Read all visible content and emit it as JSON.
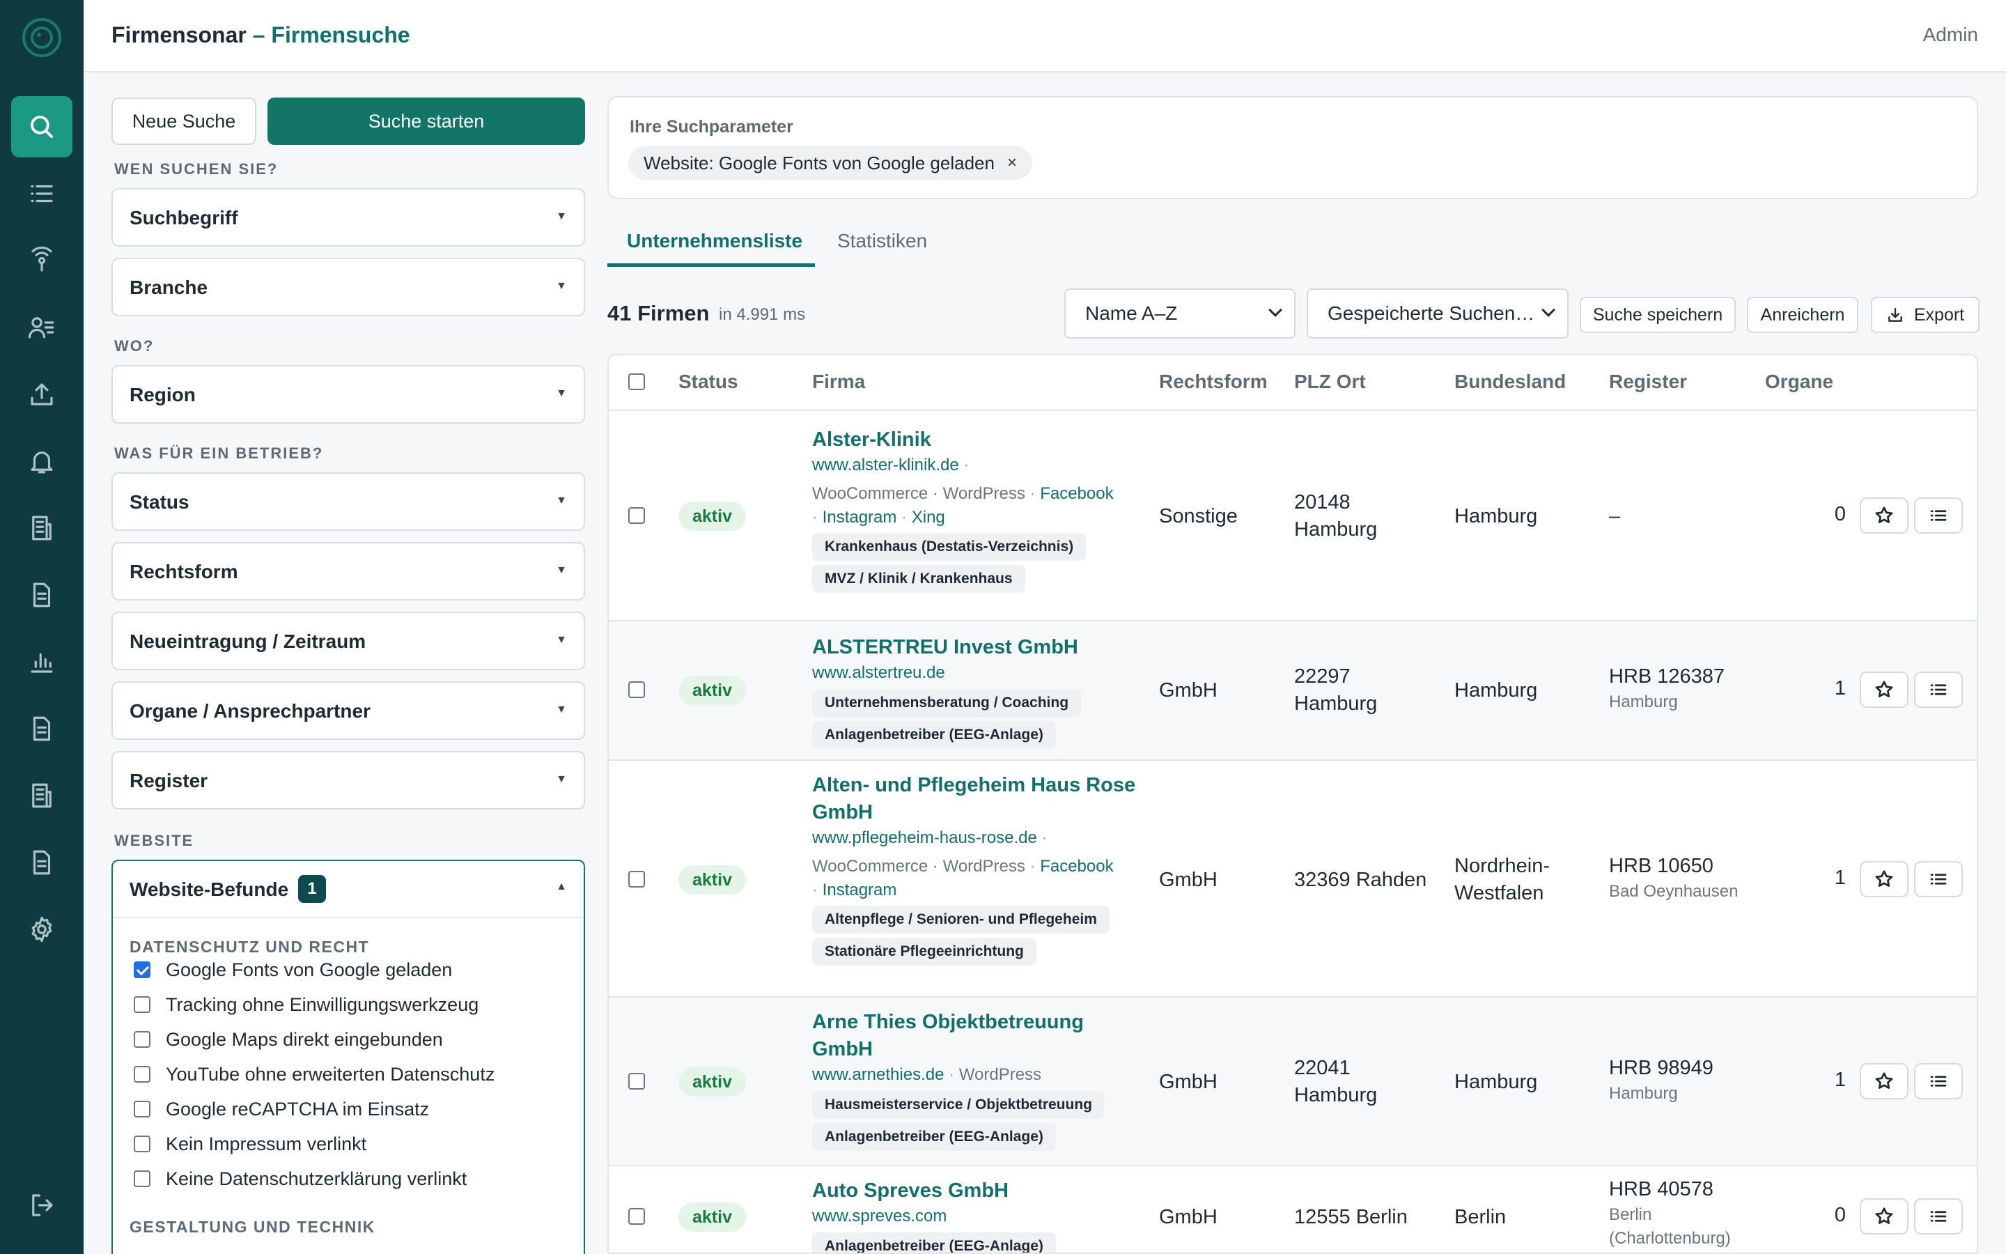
{
  "app": {
    "name": "Firmensonar",
    "separator": " – ",
    "section": "Firmensuche",
    "user": "Admin"
  },
  "sidebar": {
    "items": [
      {
        "icon": "search-icon",
        "active": true
      },
      {
        "icon": "list-icon"
      },
      {
        "icon": "radar-icon"
      },
      {
        "icon": "contacts-icon"
      },
      {
        "icon": "upload-icon"
      },
      {
        "icon": "bell-icon"
      },
      {
        "icon": "building-icon"
      },
      {
        "icon": "document-icon"
      },
      {
        "icon": "chart-icon"
      },
      {
        "icon": "document-icon"
      },
      {
        "icon": "building-icon"
      },
      {
        "icon": "document-icon"
      },
      {
        "icon": "gear-icon"
      }
    ],
    "logout_icon": "logout-icon"
  },
  "left": {
    "new_search": "Neue Suche",
    "start_search": "Suche starten",
    "sections": {
      "who": "WEN SUCHEN SIE?",
      "where": "WO?",
      "what": "WAS FÜR EIN BETRIEB?",
      "website": "WEBSITE"
    },
    "filters": {
      "suchbegriff": "Suchbegriff",
      "branche": "Branche",
      "region": "Region",
      "status": "Status",
      "rechtsform": "Rechtsform",
      "neueintragung": "Neueintragung / Zeitraum",
      "organe": "Organe / Ansprechpartner",
      "register": "Register"
    },
    "website_filter": {
      "label": "Website-Befunde",
      "count": "1",
      "group1": "DATENSCHUTZ UND RECHT",
      "options": [
        {
          "label": "Google Fonts von Google geladen",
          "checked": true
        },
        {
          "label": "Tracking ohne Einwilligungswerkzeug",
          "checked": false
        },
        {
          "label": "Google Maps direkt eingebunden",
          "checked": false
        },
        {
          "label": "YouTube ohne erweiterten Datenschutz",
          "checked": false
        },
        {
          "label": "Google reCAPTCHA im Einsatz",
          "checked": false
        },
        {
          "label": "Kein Impressum verlinkt",
          "checked": false
        },
        {
          "label": "Keine Datenschutzerklärung verlinkt",
          "checked": false
        }
      ],
      "group2": "GESTALTUNG UND TECHNIK"
    }
  },
  "params": {
    "title": "Ihre Suchparameter",
    "chip": "Website: Google Fonts von Google geladen",
    "chip_close": "×"
  },
  "tabs": {
    "list": "Unternehmensliste",
    "stats": "Statistiken"
  },
  "results": {
    "count": "41 Firmen",
    "time": "in 4.991 ms",
    "sort": "Name A–Z",
    "saved": "Gespeicherte Suchen…",
    "save_search": "Suche speichern",
    "enrich": "Anreichern",
    "export": "Export"
  },
  "table": {
    "headers": {
      "status": "Status",
      "firma": "Firma",
      "rechtsform": "Rechtsform",
      "plz": "PLZ Ort",
      "bundesland": "Bundesland",
      "register": "Register",
      "organe": "Organe"
    },
    "rows": [
      {
        "status": "aktiv",
        "name": "Alster-Klinik",
        "url": "www.alster-klinik.de",
        "tech": "WooCommerce · WordPress",
        "fb": "Facebook",
        "ig": "Instagram",
        "xing": "Xing",
        "tag1": "Krankenhaus (Destatis-Verzeichnis)",
        "tag2": "MVZ / Klinik / Krankenhaus",
        "rechtsform": "Sonstige",
        "plz": "20148",
        "ort": "Hamburg",
        "bundesland": "Hamburg",
        "register": "–",
        "register_court": "",
        "organe": "0"
      },
      {
        "status": "aktiv",
        "name": "ALSTERTREU Invest GmbH",
        "url": "www.alstertreu.de",
        "tag1": "Unternehmensberatung / Coaching",
        "tag2": "Anlagenbetreiber (EEG-Anlage)",
        "rechtsform": "GmbH",
        "plz": "22297",
        "ort": "Hamburg",
        "bundesland": "Hamburg",
        "register": "HRB 126387",
        "register_court": "Hamburg",
        "organe": "1"
      },
      {
        "status": "aktiv",
        "name": "Alten- und Pflegeheim Haus Rose GmbH",
        "url": "www.pflegeheim-haus-rose.de",
        "tech": "WooCommerce · WordPress",
        "fb": "Facebook",
        "ig": "Instagram",
        "tag1": "Altenpflege / Senioren- und Pflegeheim",
        "tag2": "Stationäre Pflegeeinrichtung",
        "rechtsform": "GmbH",
        "plz_ort": "32369 Rahden",
        "bundesland": "Nordrhein-Westfalen",
        "register": "HRB 10650",
        "register_court": "Bad Oeynhausen",
        "organe": "1"
      },
      {
        "status": "aktiv",
        "name": "Arne Thies Objektbetreuung GmbH",
        "url": "www.arnethies.de",
        "tech": "WordPress",
        "tag1": "Hausmeisterservice / Objektbetreuung",
        "tag2": "Anlagenbetreiber (EEG-Anlage)",
        "rechtsform": "GmbH",
        "plz": "22041",
        "ort": "Hamburg",
        "bundesland": "Hamburg",
        "register": "HRB 98949",
        "register_court": "Hamburg",
        "organe": "1"
      },
      {
        "status": "aktiv",
        "name": "Auto Spreves GmbH",
        "url": "www.spreves.com",
        "tag1": "Anlagenbetreiber (EEG-Anlage)",
        "rechtsform": "GmbH",
        "plz_ort": "12555 Berlin",
        "bundesland": "Berlin",
        "register": "HRB 40578",
        "register_court": "Berlin (Charlottenburg)",
        "organe": "0"
      }
    ]
  }
}
